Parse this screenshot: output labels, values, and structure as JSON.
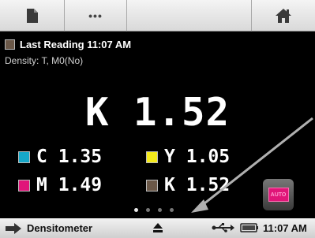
{
  "toolbar": {
    "buttons": [
      {
        "name": "document",
        "icon": "document-icon"
      },
      {
        "name": "more",
        "icon": "more-dots-icon",
        "label": "•••"
      },
      {
        "name": "blank"
      },
      {
        "name": "home",
        "icon": "home-icon"
      }
    ]
  },
  "header": {
    "title": "Last Reading 11:07 AM",
    "subtitle": "Density: T, M0(No)",
    "swatch_color": "#6b5848"
  },
  "main": {
    "reading": "K 1.52"
  },
  "values": [
    {
      "label": "C",
      "value": "1.35",
      "color": "#16a7c8"
    },
    {
      "label": "Y",
      "value": "1.05",
      "color": "#f4ea1c"
    },
    {
      "label": "M",
      "value": "1.49",
      "color": "#e0157a"
    },
    {
      "label": "K",
      "value": "1.52",
      "color": "#6b5848"
    }
  ],
  "auto_button": {
    "label": "AUTO",
    "color": "#e01578"
  },
  "pager": {
    "count": 4,
    "active": 0
  },
  "status": {
    "mode": "Densitometer",
    "time": "11:07 AM"
  },
  "colors": {
    "background": "#000000",
    "annotation_arrow": "#b0b0b0"
  }
}
